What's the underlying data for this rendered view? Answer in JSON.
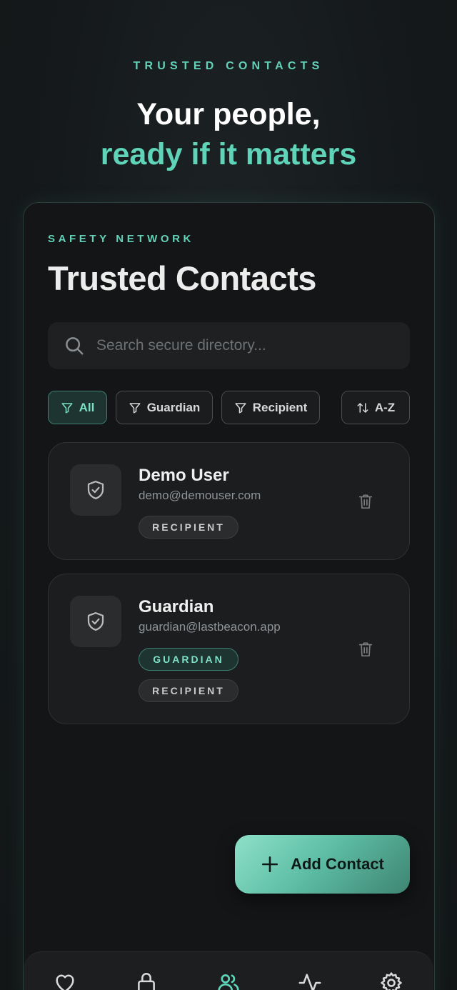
{
  "hero": {
    "eyebrow": "TRUSTED CONTACTS",
    "title_line1": "Your people,",
    "title_line2": "ready if it matters"
  },
  "card": {
    "eyebrow": "SAFETY NETWORK",
    "title": "Trusted Contacts"
  },
  "search": {
    "placeholder": "Search secure directory...",
    "value": ""
  },
  "filters": [
    {
      "label": "All",
      "active": true
    },
    {
      "label": "Guardian",
      "active": false
    },
    {
      "label": "Recipient",
      "active": false
    }
  ],
  "sort": {
    "label": "A-Z"
  },
  "contacts": [
    {
      "name": "Demo User",
      "email": "demo@demouser.com",
      "roles": [
        "RECIPIENT"
      ]
    },
    {
      "name": "Guardian",
      "email": "guardian@lastbeacon.app",
      "roles": [
        "GUARDIAN",
        "RECIPIENT"
      ]
    }
  ],
  "add_button": {
    "label": "Add Contact"
  },
  "nav": {
    "items": [
      "heart-icon",
      "lock-icon",
      "users-icon",
      "activity-icon",
      "settings-icon"
    ],
    "active_index": 2
  },
  "colors": {
    "accent": "#5fd4b8",
    "background": "#15181a",
    "card": "#1b1d1f"
  }
}
